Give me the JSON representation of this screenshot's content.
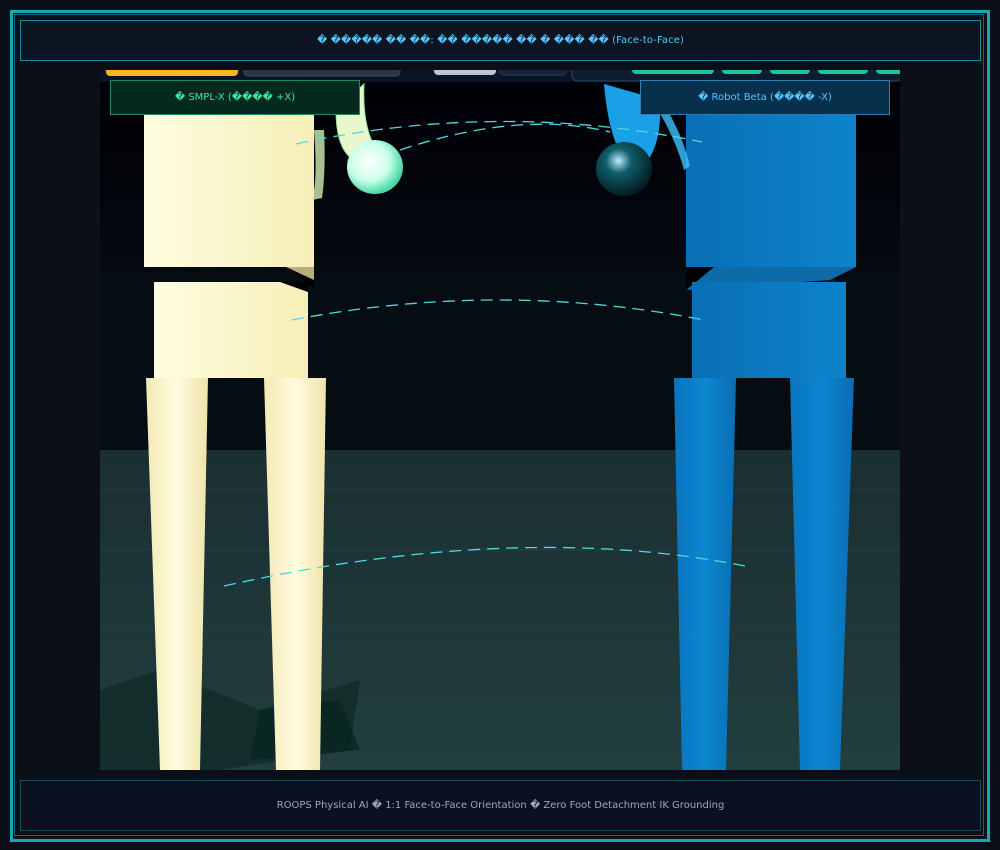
{
  "header": {
    "title": "� ����� �� ��: �� ����� �� � ��� �� (Face-to-Face)"
  },
  "labels": {
    "left_figure": "� SMPL-X (���� +X)",
    "right_figure": "� Robot Beta (���� -X)"
  },
  "footer": {
    "caption": "ROOPS Physical AI � 1:1 Face-to-Face Orientation � Zero Foot Detachment IK Grounding"
  },
  "colors": {
    "frame": "#18a7b5",
    "smplx_body": "#fff8c4",
    "robot_body": "#0a7ac2",
    "connector_line": "#4fd8e0",
    "floor": "#1d3538"
  }
}
